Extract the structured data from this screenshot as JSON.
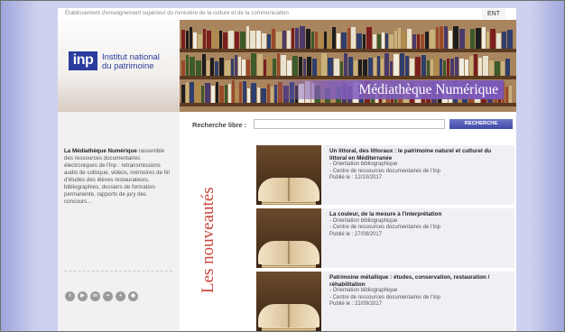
{
  "topbar": {
    "text": "Établissement d'enseignement supérieur du ministère de la culture et de la communication",
    "ent_label": "ENT"
  },
  "banner": {
    "logo_abbr": "inp",
    "logo_line1": "Institut national",
    "logo_line2": "du patrimoine",
    "title": "Médiathèque Numérique"
  },
  "sidebar": {
    "intro_bold": "La Médiathèque Numérique",
    "intro_rest": " rassemble des ressources documentaires électroniques de l'Inp : retransmissions audio de colloque, vidéos, mémoires de fin d'études des élèves restaurateurs, bibliographies, dossiers de formation permanente, rapports de jury des concours...",
    "social": [
      {
        "name": "twitter-icon",
        "glyph": "t"
      },
      {
        "name": "youtube-icon",
        "glyph": "▶"
      },
      {
        "name": "linkedin-icon",
        "glyph": "in"
      },
      {
        "name": "flickr-icon",
        "glyph": "••"
      },
      {
        "name": "plus-icon",
        "glyph": "+"
      },
      {
        "name": "rss-icon",
        "glyph": "◉"
      }
    ]
  },
  "search": {
    "label": "Recherche libre :",
    "placeholder": "",
    "button": "RECHERCHE"
  },
  "news": {
    "heading": "Les nouveautés",
    "items": [
      {
        "title": "Un littoral, des littoraux : le patrimoine naturel et culturel du littoral en Méditerranée",
        "line1": "- Orientation bibliographique",
        "line2": "- Centre de ressources documentaires de l'Inp",
        "date": "Publié le : 12/10/2017"
      },
      {
        "title": "La couleur, de la mesure à l'interprétation",
        "line1": "- Orientation bibliographique",
        "line2": "- Centre de ressources documentaires de l'Inp",
        "date": "Publié le : 27/09/2017"
      },
      {
        "title": "Patrimoine métallique : études, conservation, restauration / réhabilitation",
        "line1": "- Orientation bibliographique",
        "line2": "- Centre de ressources documentaires de l'Inp",
        "date": "Publié le : 22/09/2017"
      }
    ]
  },
  "colors": {
    "accent": "#2a3d9c",
    "title_band": "#7c58b8",
    "heading_red": "#c8473c",
    "side_bg": "#cdd1ef"
  }
}
